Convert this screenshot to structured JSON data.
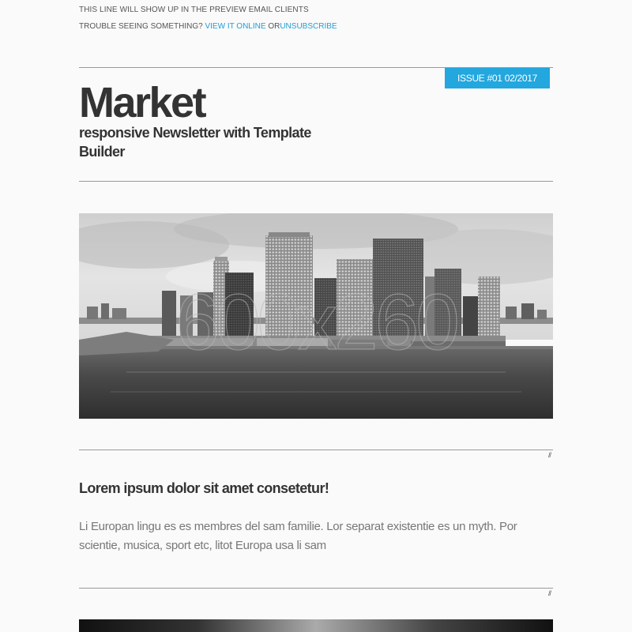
{
  "preheader": {
    "text": "THIS LINE WILL SHOW UP IN THE PREVIEW EMAIL CLIENTS"
  },
  "trouble": {
    "prefix": "TROUBLE SEEING SOMETHING?",
    "view_online": "VIEW IT ONLINE",
    "or": "OR",
    "unsubscribe": "UNSUBSCRIBE"
  },
  "header": {
    "issue": "ISSUE #01 02/2017",
    "title": "Market",
    "subtitle": "responsive Newsletter with Template Builder"
  },
  "hero": {
    "placeholder": "600x260"
  },
  "divider": {
    "mark": "//"
  },
  "article": {
    "title": "Lorem ipsum dolor sit amet consetetur!",
    "body": "Li Europan lingu es es membres del sam familie. Lor separat existentie es un myth. Por scientie, musica, sport etc, litot Europa usa li sam"
  },
  "colors": {
    "accent": "#22a7df",
    "link": "#1e9fd6",
    "text": "#333333",
    "body_text": "#777777",
    "background": "#fafafa"
  }
}
